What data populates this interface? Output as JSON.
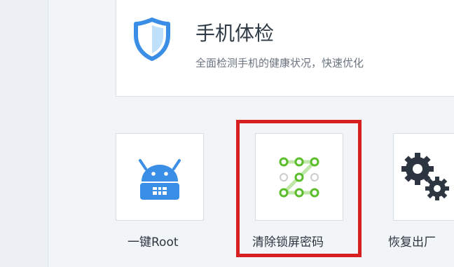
{
  "health_check": {
    "title": "手机体检",
    "subtitle": "全面检测手机的健康状况，快速优化"
  },
  "tools": {
    "root": {
      "label": "一键Root"
    },
    "clear_lock": {
      "label": "清除锁屏密码"
    },
    "factory_reset": {
      "label": "恢复出厂"
    }
  },
  "icons": {
    "health_check": "shield-icon",
    "root": "android-icon",
    "clear_lock": "pattern-lock-icon",
    "factory_reset": "gears-icon"
  },
  "colors": {
    "accent_blue": "#3a8ee6",
    "pattern_green": "#5bbd2a",
    "highlight_red": "#d81f1f"
  }
}
